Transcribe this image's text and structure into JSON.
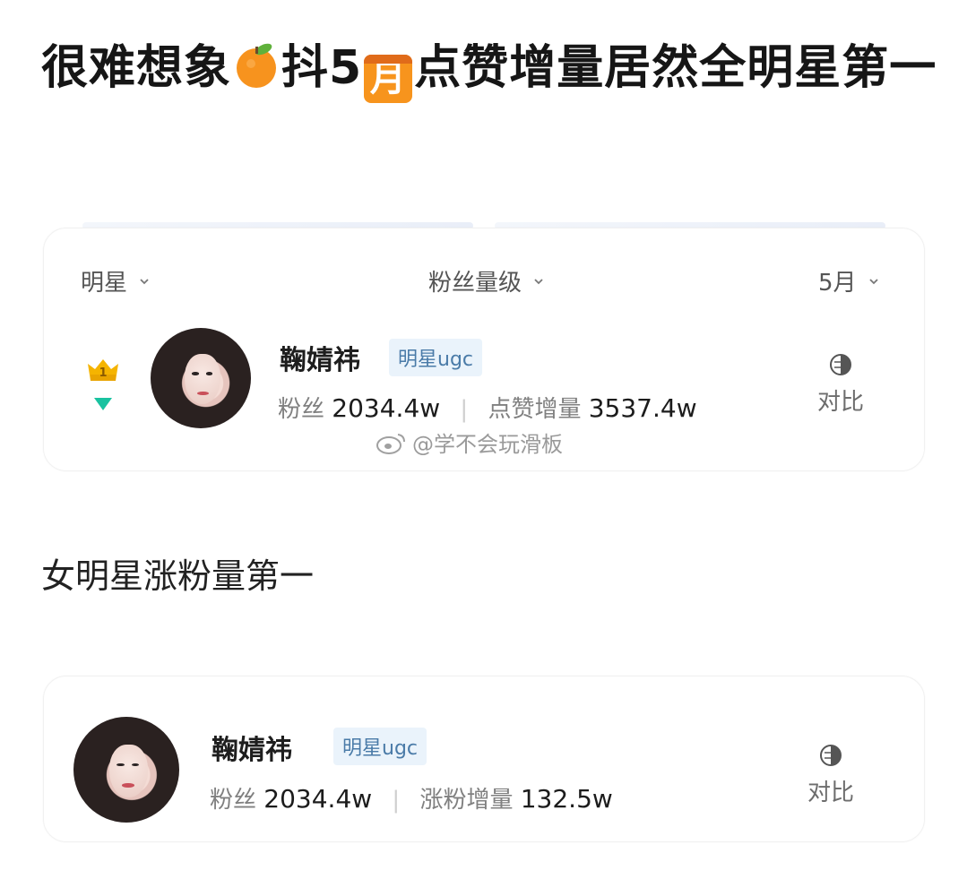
{
  "headline": {
    "part1": "很难想象",
    "orange_icon": "orange-emoji",
    "part2": "抖5",
    "month_emoji": "月",
    "part3": "点赞增量居然全明星第一"
  },
  "filters": {
    "star": "明星",
    "fans_level": "粉丝量级",
    "month": "5月"
  },
  "card1": {
    "rank": "1",
    "name": "鞠婧祎",
    "tag": "明星ugc",
    "fans_label": "粉丝",
    "fans_value": "2034.4w",
    "metric_label": "点赞增量",
    "metric_value": "3537.4w",
    "compare_label": "对比"
  },
  "watermark": "@学不会玩滑板",
  "section2_title": "女明星涨粉量第一",
  "card2": {
    "name": "鞠婧祎",
    "tag": "明星ugc",
    "fans_label": "粉丝",
    "fans_value": "2034.4w",
    "metric_label": "涨粉增量",
    "metric_value": "132.5w",
    "compare_label": "对比"
  },
  "colors": {
    "accent_teal": "#19c2a0",
    "crown_gold": "#f5b400",
    "tag_bg": "#eaf3fb",
    "tag_text": "#4a7ba8"
  }
}
